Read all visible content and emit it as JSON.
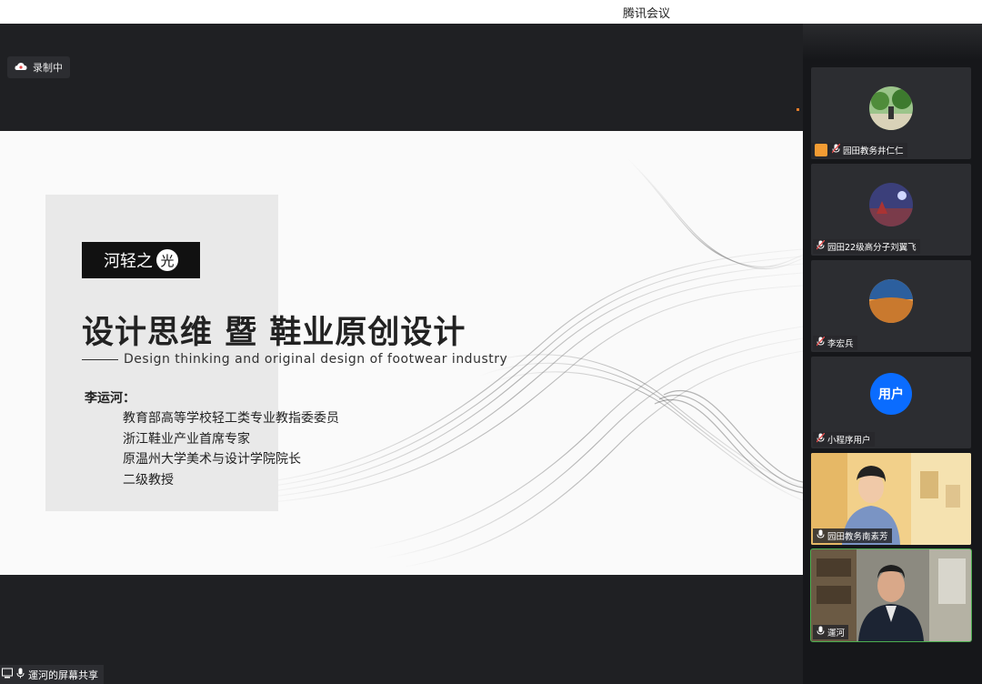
{
  "window": {
    "title": "腾讯会议"
  },
  "recording": {
    "label": "录制中"
  },
  "slide": {
    "brand": "河轻之",
    "brand_circle": "光",
    "title": "设计思维 暨 鞋业原创设计",
    "subtitle": "Design thinking and original design of footwear industry",
    "author": "李运河：",
    "credentials": [
      "教育部高等学校轻工类专业教指委委员",
      "浙江鞋业产业首席专家",
      "原温州大学美术与设计学院院长",
      "二级教授"
    ]
  },
  "screen_share": {
    "label": "運河的屏幕共享"
  },
  "participants": [
    {
      "name": "园田教务井仁仁",
      "avatar": "photo-trees-icon"
    },
    {
      "name": "园田22级高分子刘翼飞",
      "avatar": "photo-night-icon"
    },
    {
      "name": "李宏兵",
      "avatar": "photo-landscape-icon"
    },
    {
      "name": "小程序用户",
      "avatar_text": "用户"
    },
    {
      "name": "园田教务南素芳",
      "avatar": "video-feed"
    },
    {
      "name": "運河",
      "avatar": "video-feed",
      "active": true
    }
  ],
  "colors": {
    "accent": "#0a6cff",
    "active_border": "#4caf50",
    "stage": "#1f2023"
  }
}
